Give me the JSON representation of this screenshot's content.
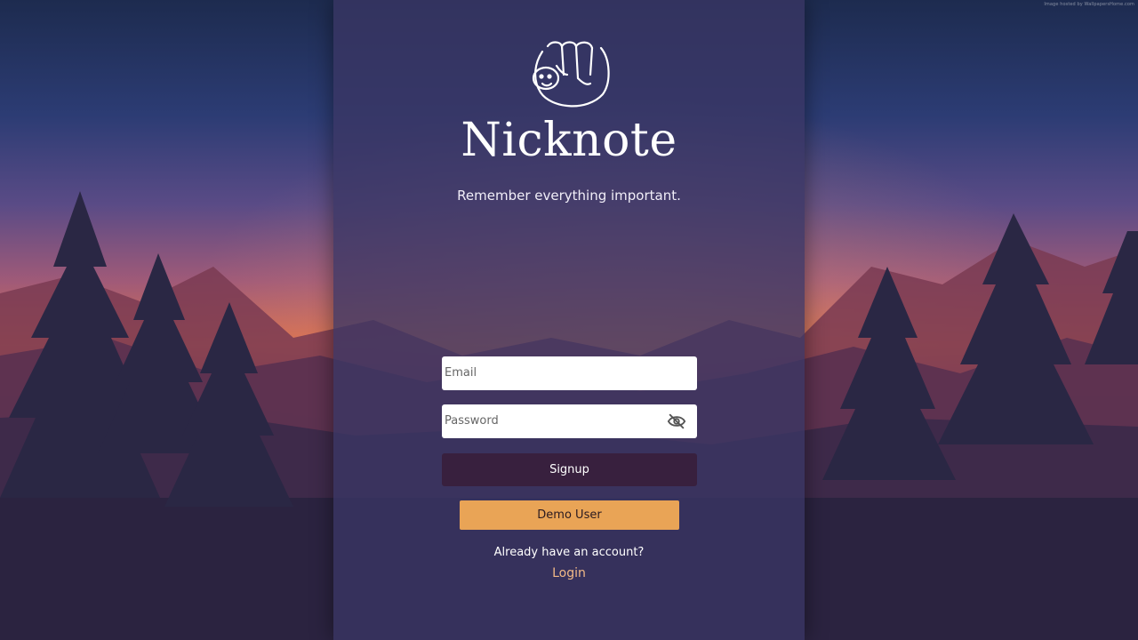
{
  "app": {
    "title": "Nicknote",
    "tagline": "Remember everything important.",
    "logo_icon": "sloth-icon"
  },
  "form": {
    "email_placeholder": "Email",
    "password_placeholder": "Password",
    "password_toggle_icon": "eye-slash-icon",
    "signup_label": "Signup",
    "demo_label": "Demo User"
  },
  "footer": {
    "prompt": "Already have an account?",
    "login_label": "Login"
  },
  "background": {
    "watermark": "Image hosted by WallpapersHome.com"
  },
  "colors": {
    "panel": "#3a3664",
    "signup_button": "#38203e",
    "demo_button": "#e9a456",
    "login_link": "#f2b987"
  }
}
